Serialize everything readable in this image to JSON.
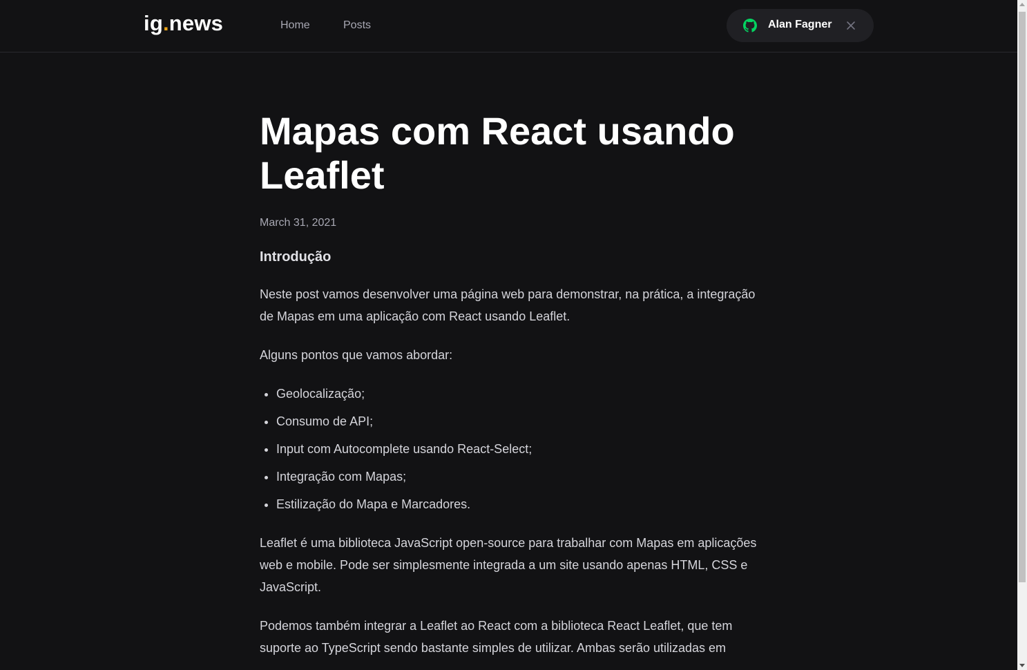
{
  "header": {
    "logo_main": "ig",
    "logo_dot": ".",
    "logo_rest": "news",
    "nav": {
      "home": "Home",
      "posts": "Posts"
    },
    "user": {
      "name": "Alan Fagner",
      "icon": "github-icon",
      "icon_color": "#04d361"
    }
  },
  "article": {
    "title": "Mapas com React usando Leaflet",
    "date": "March 31, 2021",
    "heading": "Introdução",
    "p1": "Neste post vamos desenvolver uma página web para demonstrar, na prática, a integração de Mapas em uma aplicação com React usando Leaflet.",
    "p2": "Alguns pontos que vamos abordar:",
    "list": [
      "Geolocalização;",
      "Consumo de API;",
      "Input com Autocomplete usando React-Select;",
      "Integração com Mapas;",
      "Estilização do Mapa e Marcadores."
    ],
    "p3": "Leaflet é uma biblioteca JavaScript open-source para trabalhar com Mapas em aplicações web e mobile. Pode ser simplesmente integrada a um site usando apenas HTML, CSS e JavaScript.",
    "p4": "Podemos também integrar a Leaflet ao React com a biblioteca React Leaflet, que tem suporte ao TypeScript sendo bastante simples de utilizar. Ambas serão utilizadas em"
  },
  "colors": {
    "background": "#121214",
    "accent": "#eba417",
    "github_green": "#04d361"
  }
}
